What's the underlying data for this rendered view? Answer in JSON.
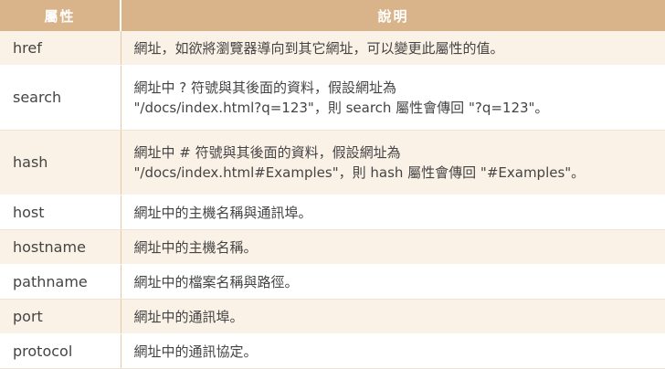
{
  "header": {
    "col1": "屬性",
    "col2": "說明"
  },
  "rows": [
    {
      "key": "href",
      "desc": "網址，如欲將瀏覽器導向到其它網址，可以變更此屬性的值。"
    },
    {
      "key": "search",
      "desc1": "網址中 ? 符號與其後面的資料，假設網址為",
      "desc2": "\"/docs/index.html?q=123\"，則 search 屬性會傳回 \"?q=123\"。"
    },
    {
      "key": "hash",
      "desc1": "網址中 # 符號與其後面的資料，假設網址為",
      "desc2": "\"/docs/index.html#Examples\"，則 hash 屬性會傳回 \"#Examples\"。"
    },
    {
      "key": "host",
      "desc": "網址中的主機名稱與通訊埠。"
    },
    {
      "key": "hostname",
      "desc": "網址中的主機名稱。"
    },
    {
      "key": "pathname",
      "desc": "網址中的檔案名稱與路徑。"
    },
    {
      "key": "port",
      "desc": "網址中的通訊埠。"
    },
    {
      "key": "protocol",
      "desc": "網址中的通訊協定。"
    }
  ]
}
